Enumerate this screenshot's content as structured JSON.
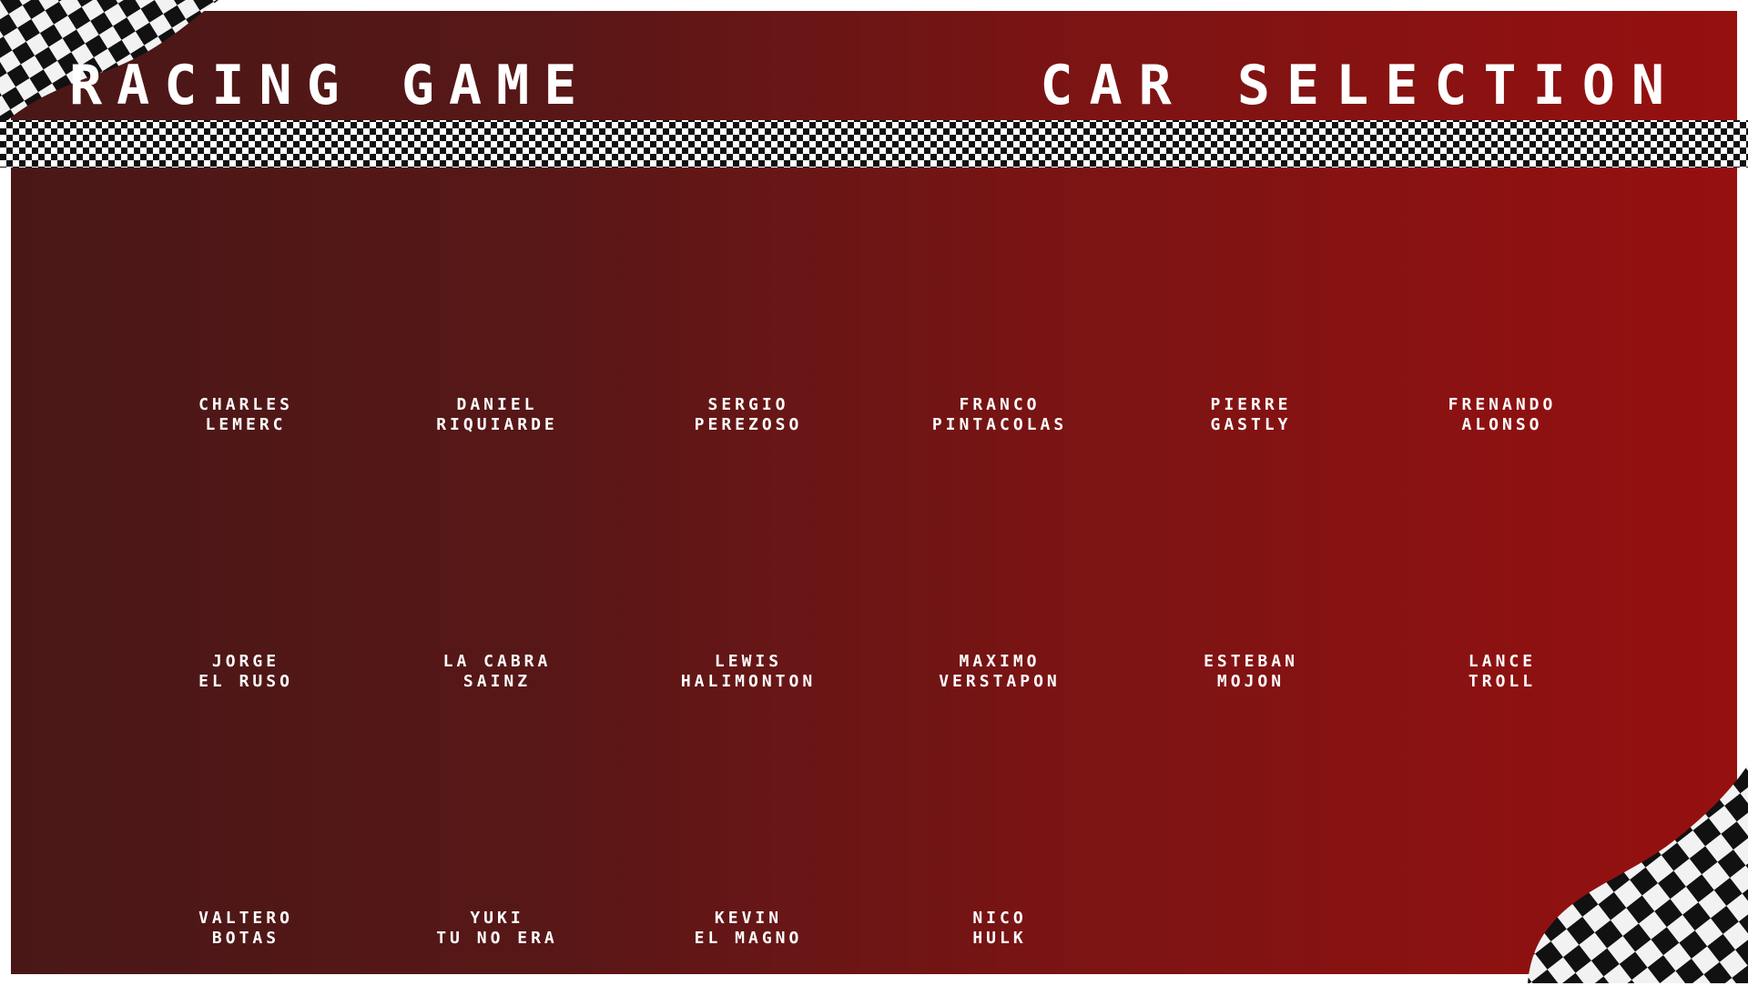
{
  "header": {
    "game_title": "RACING GAME",
    "screen_title": "CAR SELECTION"
  },
  "drivers": [
    {
      "first": "CHARLES",
      "last": "LEMERC"
    },
    {
      "first": "DANIEL",
      "last": "RIQUIARDE"
    },
    {
      "first": "SERGIO",
      "last": "PEREZOSO"
    },
    {
      "first": "FRANCO",
      "last": "PINTACOLAS"
    },
    {
      "first": "PIERRE",
      "last": "GASTLY"
    },
    {
      "first": "FRENANDO",
      "last": "ALONSO"
    },
    {
      "first": "JORGE",
      "last": "EL RUSO"
    },
    {
      "first": "LA CABRA",
      "last": "SAINZ"
    },
    {
      "first": "LEWIS",
      "last": "HALIMONTON"
    },
    {
      "first": "MAXIMO",
      "last": "VERSTAPON"
    },
    {
      "first": "ESTEBAN",
      "last": "MOJON"
    },
    {
      "first": "LANCE",
      "last": "TROLL"
    },
    {
      "first": "VALTERO",
      "last": "BOTAS"
    },
    {
      "first": "YUKI",
      "last": "TU NO ERA"
    },
    {
      "first": "KEVIN",
      "last": "EL MAGNO"
    },
    {
      "first": "NICO",
      "last": "HULK"
    }
  ],
  "colors": {
    "panel_left": "#4a1717",
    "panel_right": "#961010",
    "text": "#ffffff",
    "checker_dark": "#111111"
  }
}
